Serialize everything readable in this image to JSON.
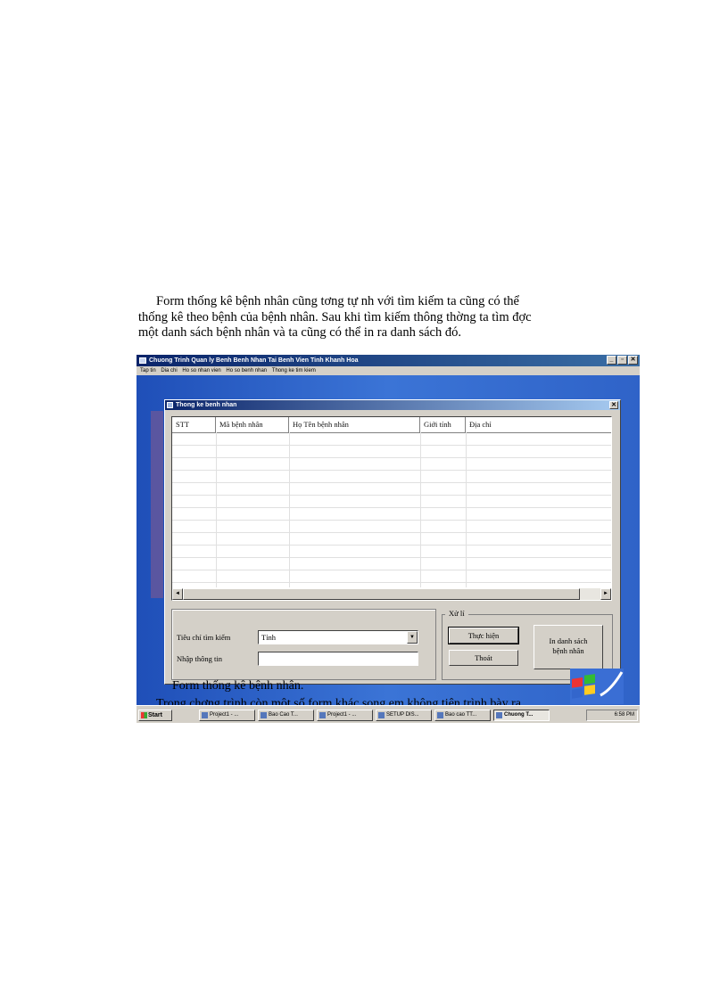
{
  "paragraph": {
    "lines": [
      "Form thống kê bệnh nhân cũng tơng   tự nh    với tìm kiếm ta  cũng có thể",
      "thống kê theo bệnh của bệnh nhân. Sau khi tìm kiếm thông thờng    ta tìm đợc",
      "một danh sách bệnh nhân và ta cũng có thể in ra danh sách đó."
    ]
  },
  "app": {
    "title": "Chuong Trinh Quan ly Benh Benh Nhan Tai Benh Vien Tinh Khanh Hoa",
    "window_buttons": [
      "_",
      "▫",
      "✕"
    ],
    "menu": [
      "Tap tin",
      "Dia chi",
      "Ho so nhan vien",
      "Ho so benh nhan",
      "Thong ke tim kiem"
    ]
  },
  "dialog": {
    "title": "Thong ke benh nhan",
    "close": "✕",
    "columns": [
      "STT",
      "Mã bệnh nhân",
      "Họ Tên bệnh nhân",
      "Giới tính",
      "Địa chỉ"
    ],
    "scroll_left": "◄",
    "scroll_right": "►",
    "search_label": "Tiêu chí tìm kiếm",
    "search_value": "Tỉnh",
    "input_label": "Nhập thông tin",
    "input_value": "",
    "group_label": "Xử lí",
    "run_button": "Thực hiện",
    "exit_button": "Thoát",
    "print_button_line1": "In danh sách",
    "print_button_line2": "bệnh nhân"
  },
  "captions": {
    "figure": "Form thống kê bệnh nhân.",
    "note": "Trong chơng    trình còn một số form khác song em không tiện trình bày ra."
  },
  "taskbar": {
    "start": "Start",
    "tasks": [
      "Project1 - ...",
      "Bao Cao T...",
      "Project1 - ...",
      "SETUP DIS...",
      "Bao cao TT...",
      "Chuong T..."
    ],
    "clock": "6:58 PM"
  },
  "colors": {
    "titlebar": "#0a246a",
    "desktop": "#3a6ed4",
    "face": "#d4d0c8"
  }
}
